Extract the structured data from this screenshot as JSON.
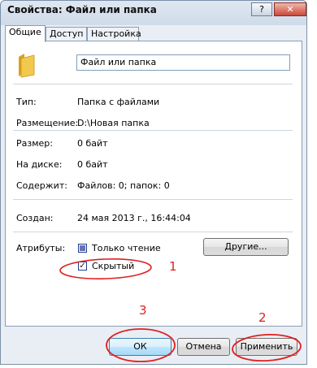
{
  "window": {
    "title": "Свойства: Файл или папка",
    "help_glyph": "?",
    "close_glyph": "✕"
  },
  "tabs": [
    {
      "label": "Общие"
    },
    {
      "label": "Доступ"
    },
    {
      "label": "Настройка"
    }
  ],
  "general": {
    "name_value": "Файл или папка",
    "rows": [
      {
        "label": "Тип:",
        "value": "Папка с файлами"
      },
      {
        "label": "Размещение:",
        "value": "D:\\Новая папка"
      },
      {
        "label": "Размер:",
        "value": "0 байт"
      },
      {
        "label": "На диске:",
        "value": "0 байт"
      },
      {
        "label": "Содержит:",
        "value": "Файлов: 0; папок: 0"
      },
      {
        "label": "Создан:",
        "value": "24 мая 2013 г., 16:44:04"
      }
    ],
    "attributes_label": "Атрибуты:",
    "readonly_label": "Только чтение",
    "hidden_label": "Скрытый",
    "hidden_check_glyph": "✓",
    "other_button": "Другие..."
  },
  "buttons": {
    "ok": "ОК",
    "cancel": "Отмена",
    "apply": "Применить"
  },
  "annotations": [
    "1",
    "2",
    "3"
  ],
  "colors": {
    "annotation": "#e02020",
    "folder": "#f2c94c"
  }
}
